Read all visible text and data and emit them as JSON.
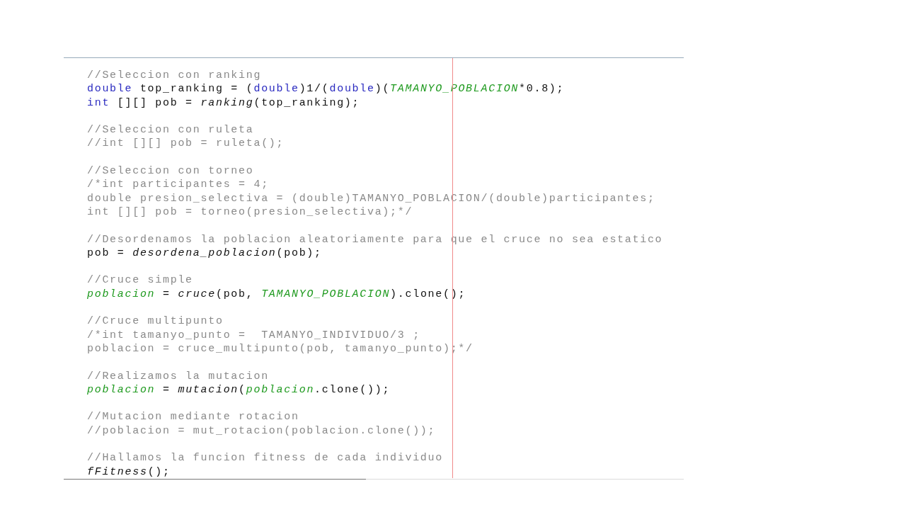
{
  "code_lines": [
    {
      "kind": "code",
      "tokens": [
        {
          "kind": "comment",
          "t": "//Seleccion con ranking"
        }
      ]
    },
    {
      "kind": "code",
      "tokens": [
        {
          "kind": "keyword",
          "t": "double"
        },
        {
          "kind": "plain",
          "t": " top_ranking = ("
        },
        {
          "kind": "keyword",
          "t": "double"
        },
        {
          "kind": "plain",
          "t": ")1/("
        },
        {
          "kind": "keyword",
          "t": "double"
        },
        {
          "kind": "plain",
          "t": ")("
        },
        {
          "kind": "field",
          "t": "TAMANYO_POBLACION"
        },
        {
          "kind": "plain",
          "t": "*0.8);"
        }
      ]
    },
    {
      "kind": "code",
      "tokens": [
        {
          "kind": "keyword",
          "t": "int"
        },
        {
          "kind": "plain",
          "t": " [][] pob = "
        },
        {
          "kind": "method",
          "t": "ranking"
        },
        {
          "kind": "plain",
          "t": "(top_ranking);"
        }
      ]
    },
    {
      "kind": "blank"
    },
    {
      "kind": "code",
      "tokens": [
        {
          "kind": "comment",
          "t": "//Seleccion con ruleta"
        }
      ]
    },
    {
      "kind": "code",
      "tokens": [
        {
          "kind": "comment",
          "t": "//int [][] pob = ruleta();"
        }
      ]
    },
    {
      "kind": "blank"
    },
    {
      "kind": "code",
      "tokens": [
        {
          "kind": "comment",
          "t": "//Seleccion con torneo"
        }
      ]
    },
    {
      "kind": "code",
      "tokens": [
        {
          "kind": "comment",
          "t": "/*int participantes = 4;"
        }
      ]
    },
    {
      "kind": "code",
      "tokens": [
        {
          "kind": "comment",
          "t": "double presion_selectiva = (double)TAMANYO_POBLACION/(double)participantes;"
        }
      ]
    },
    {
      "kind": "code",
      "tokens": [
        {
          "kind": "comment",
          "t": "int [][] pob = torneo(presion_selectiva);*/"
        }
      ]
    },
    {
      "kind": "blank"
    },
    {
      "kind": "code",
      "tokens": [
        {
          "kind": "comment",
          "t": "//Desordenamos la poblacion aleatoriamente para que el cruce no sea estatico"
        }
      ]
    },
    {
      "kind": "code",
      "tokens": [
        {
          "kind": "plain",
          "t": "pob = "
        },
        {
          "kind": "method",
          "t": "desordena_poblacion"
        },
        {
          "kind": "plain",
          "t": "(pob);"
        }
      ]
    },
    {
      "kind": "blank"
    },
    {
      "kind": "code",
      "tokens": [
        {
          "kind": "comment",
          "t": "//Cruce simple"
        }
      ]
    },
    {
      "kind": "code",
      "tokens": [
        {
          "kind": "field",
          "t": "poblacion"
        },
        {
          "kind": "plain",
          "t": " = "
        },
        {
          "kind": "method",
          "t": "cruce"
        },
        {
          "kind": "plain",
          "t": "(pob, "
        },
        {
          "kind": "field",
          "t": "TAMANYO_POBLACION"
        },
        {
          "kind": "plain",
          "t": ").clone();"
        }
      ]
    },
    {
      "kind": "blank"
    },
    {
      "kind": "code",
      "tokens": [
        {
          "kind": "comment",
          "t": "//Cruce multipunto"
        }
      ]
    },
    {
      "kind": "code",
      "tokens": [
        {
          "kind": "comment",
          "t": "/*int tamanyo_punto =  TAMANYO_INDIVIDUO/3 ;"
        }
      ]
    },
    {
      "kind": "code",
      "tokens": [
        {
          "kind": "comment",
          "t": "poblacion = cruce_multipunto(pob, tamanyo_punto);*/"
        }
      ]
    },
    {
      "kind": "blank"
    },
    {
      "kind": "code",
      "tokens": [
        {
          "kind": "comment",
          "t": "//Realizamos la mutacion"
        }
      ]
    },
    {
      "kind": "code",
      "tokens": [
        {
          "kind": "field",
          "t": "poblacion"
        },
        {
          "kind": "plain",
          "t": " = "
        },
        {
          "kind": "method",
          "t": "mutacion"
        },
        {
          "kind": "plain",
          "t": "("
        },
        {
          "kind": "field",
          "t": "poblacion"
        },
        {
          "kind": "plain",
          "t": ".clone());"
        }
      ]
    },
    {
      "kind": "blank"
    },
    {
      "kind": "code",
      "tokens": [
        {
          "kind": "comment",
          "t": "//Mutacion mediante rotacion"
        }
      ]
    },
    {
      "kind": "code",
      "tokens": [
        {
          "kind": "comment",
          "t": "//poblacion = mut_rotacion(poblacion.clone());"
        }
      ]
    },
    {
      "kind": "blank"
    },
    {
      "kind": "code",
      "tokens": [
        {
          "kind": "comment",
          "t": "//Hallamos la funcion fitness de cada individuo"
        }
      ]
    },
    {
      "kind": "code",
      "tokens": [
        {
          "kind": "method",
          "t": "fFitness"
        },
        {
          "kind": "plain",
          "t": "();"
        }
      ]
    }
  ]
}
